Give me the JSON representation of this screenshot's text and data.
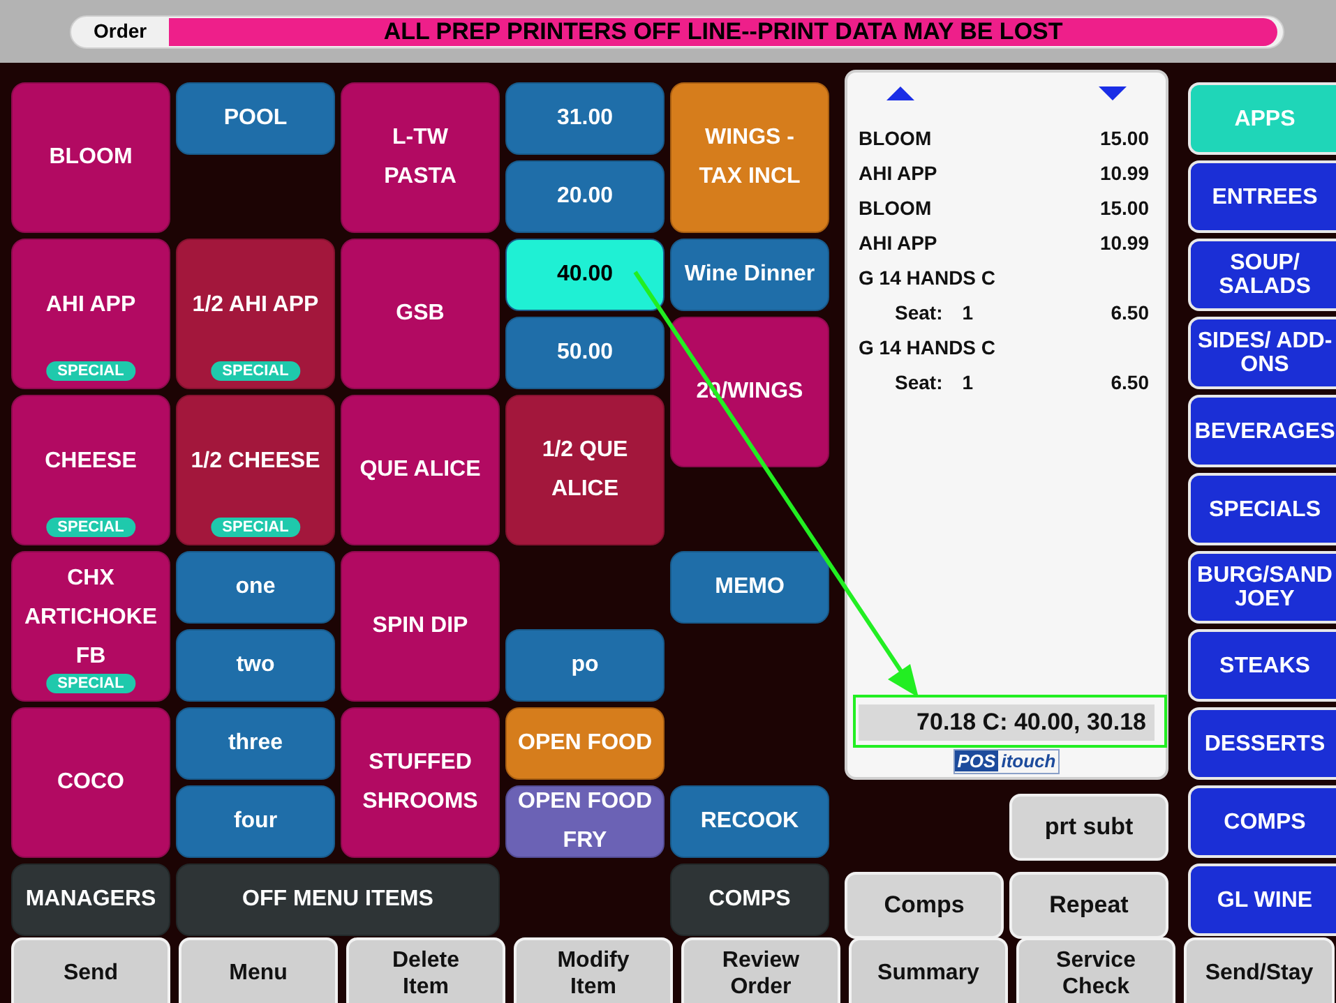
{
  "header": {
    "order_label": "Order",
    "alert": "ALL PREP PRINTERS OFF LINE--PRINT DATA MAY BE LOST"
  },
  "menu_buttons": [
    {
      "label": "BLOOM",
      "kind": "item",
      "selected": false
    },
    {
      "label": "POOL",
      "kind": "blue",
      "selected": false
    },
    {
      "label": "L-TW PASTA",
      "kind": "item",
      "selected": false
    },
    {
      "label": "31.00",
      "kind": "blue",
      "selected": false
    },
    {
      "label": "WINGS - TAX INCL",
      "kind": "orange",
      "selected": false
    },
    {
      "label": "20.00",
      "kind": "blue",
      "selected": false
    },
    {
      "label": "AHI APP",
      "kind": "item",
      "selected": false,
      "badge": "SPECIAL"
    },
    {
      "label": "1/2 AHI APP",
      "kind": "half",
      "selected": false,
      "badge": "SPECIAL"
    },
    {
      "label": "GSB",
      "kind": "item",
      "selected": false
    },
    {
      "label": "40.00",
      "kind": "blue",
      "selected": true
    },
    {
      "label": "Wine Dinner",
      "kind": "blue",
      "selected": false
    },
    {
      "label": "50.00",
      "kind": "blue",
      "selected": false
    },
    {
      "label": "20/WINGS",
      "kind": "item",
      "selected": false
    },
    {
      "label": "CHEESE",
      "kind": "item",
      "selected": false,
      "badge": "SPECIAL"
    },
    {
      "label": "1/2 CHEESE",
      "kind": "half",
      "selected": false,
      "badge": "SPECIAL"
    },
    {
      "label": "QUE ALICE",
      "kind": "item",
      "selected": false
    },
    {
      "label": "1/2 QUE ALICE",
      "kind": "half",
      "selected": false
    },
    {
      "label": "CHX ARTICHOKE FB",
      "kind": "item",
      "selected": false,
      "badge": "SPECIAL"
    },
    {
      "label": "one",
      "kind": "blue",
      "selected": false
    },
    {
      "label": "SPIN DIP",
      "kind": "item",
      "selected": false
    },
    {
      "label": "MEMO",
      "kind": "blue",
      "selected": false
    },
    {
      "label": "two",
      "kind": "blue",
      "selected": false
    },
    {
      "label": "po",
      "kind": "blue",
      "selected": false
    },
    {
      "label": "COCO",
      "kind": "item",
      "selected": false
    },
    {
      "label": "three",
      "kind": "blue",
      "selected": false
    },
    {
      "label": "STUFFED SHROOMS",
      "kind": "item",
      "selected": false
    },
    {
      "label": "OPEN FOOD",
      "kind": "orange",
      "selected": false
    },
    {
      "label": "four",
      "kind": "blue",
      "selected": false
    },
    {
      "label": "OPEN FOOD FRY",
      "kind": "purple",
      "selected": false
    },
    {
      "label": "RECOOK",
      "kind": "blue",
      "selected": false
    },
    {
      "label": "MANAGERS",
      "kind": "dark",
      "selected": false
    },
    {
      "label": "OFF MENU ITEMS",
      "kind": "dark",
      "selected": false
    },
    {
      "label": "COMPS",
      "kind": "dark",
      "selected": false
    }
  ],
  "check": {
    "lines": [
      {
        "kind": "item",
        "name": "BLOOM",
        "price": "15.00"
      },
      {
        "kind": "item",
        "name": "AHI APP",
        "price": "10.99"
      },
      {
        "kind": "item",
        "name": "BLOOM",
        "price": "15.00"
      },
      {
        "kind": "item",
        "name": "AHI APP",
        "price": "10.99"
      },
      {
        "kind": "item",
        "name": "G 14 HANDS C"
      },
      {
        "kind": "seat",
        "name": "Seat:",
        "seat": "1",
        "price": "6.50"
      },
      {
        "kind": "item",
        "name": "G 14 HANDS C"
      },
      {
        "kind": "seat",
        "name": "Seat:",
        "seat": "1",
        "price": "6.50"
      }
    ],
    "total": "70.18 C: 40.00,  30.18",
    "logo": {
      "part_1": "POS",
      "part_2": "itouch"
    }
  },
  "check_buttons": [
    "prt subt",
    "Comps",
    "Repeat"
  ],
  "categories": [
    {
      "label": "APPS",
      "selected": true
    },
    {
      "label": "ENTREES",
      "selected": false
    },
    {
      "label": "SOUP/ SALADS",
      "selected": false
    },
    {
      "label": "SIDES/ ADD-ONS",
      "selected": false
    },
    {
      "label": "BEVERAGES",
      "selected": false
    },
    {
      "label": "SPECIALS",
      "selected": false
    },
    {
      "label": "BURG/SAND JOEY",
      "selected": false
    },
    {
      "label": "STEAKS",
      "selected": false
    },
    {
      "label": "DESSERTS",
      "selected": false
    },
    {
      "label": "COMPS",
      "selected": false
    },
    {
      "label": "GL WINE",
      "selected": false
    }
  ],
  "footer_buttons": [
    "Send",
    "Menu",
    "Delete Item",
    "Modify Item",
    "Review Order",
    "Summary",
    "Service Check",
    "Send/Stay"
  ]
}
